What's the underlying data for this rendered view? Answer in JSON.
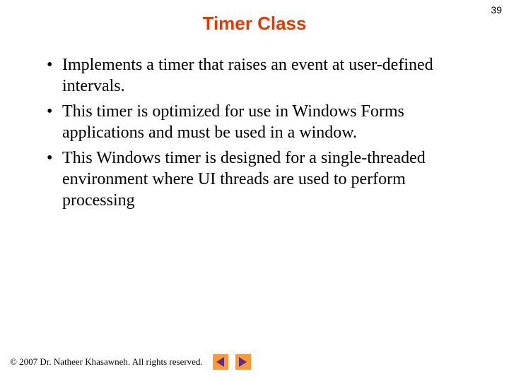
{
  "page_number": "39",
  "title": "Timer Class",
  "bullets": [
    "Implements a timer that raises an event at user-defined intervals.",
    "This timer is optimized for use in Windows Forms applications and must be used in a window.",
    "This Windows timer is designed for a single-threaded environment where UI threads are used to perform processing"
  ],
  "footer": {
    "copyright": "© 2007 Dr. Natheer Khasawneh. All rights reserved."
  }
}
